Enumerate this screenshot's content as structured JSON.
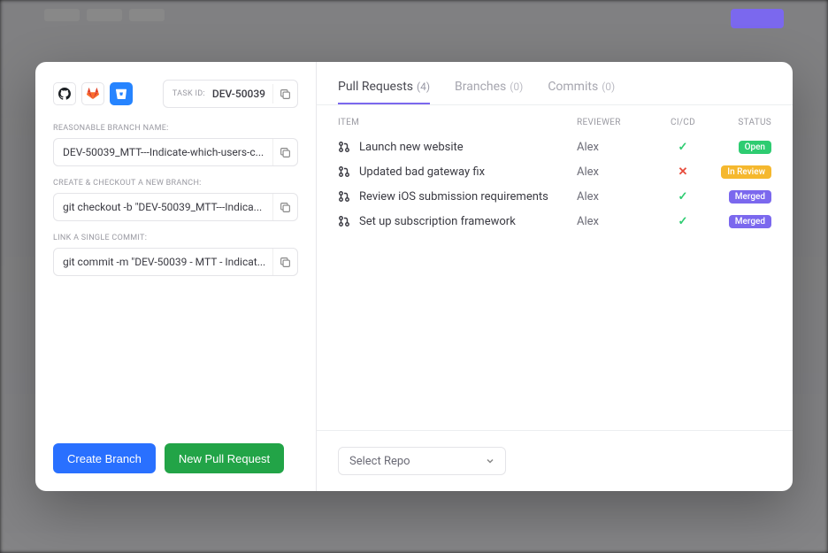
{
  "task": {
    "id_label": "TASK ID:",
    "id": "DEV-50039"
  },
  "fields": {
    "branch_name_label": "REASONABLE BRANCH NAME:",
    "branch_name": "DEV-50039_MTT---Indicate-which-users-c...",
    "checkout_label": "CREATE & CHECKOUT A NEW BRANCH:",
    "checkout": "git checkout -b \"DEV-50039_MTT---Indica...",
    "commit_label": "LINK A SINGLE COMMIT:",
    "commit": "git commit -m \"DEV-50039 - MTT - Indicat..."
  },
  "buttons": {
    "create_branch": "Create Branch",
    "new_pr": "New Pull Request"
  },
  "tabs": {
    "pr_label": "Pull Requests",
    "pr_count": "(4)",
    "branches_label": "Branches",
    "branches_count": "(0)",
    "commits_label": "Commits",
    "commits_count": "(0)"
  },
  "columns": {
    "item": "ITEM",
    "reviewer": "REVIEWER",
    "cicd": "CI/CD",
    "status": "STATUS"
  },
  "pull_requests": [
    {
      "title": "Launch new website",
      "reviewer": "Alex",
      "ci": "pass",
      "status": "Open"
    },
    {
      "title": "Updated bad gateway fix",
      "reviewer": "Alex",
      "ci": "fail",
      "status": "In Review"
    },
    {
      "title": "Review iOS submission requirements",
      "reviewer": "Alex",
      "ci": "pass",
      "status": "Merged"
    },
    {
      "title": "Set up subscription framework",
      "reviewer": "Alex",
      "ci": "pass",
      "status": "Merged"
    }
  ],
  "footer": {
    "select_repo": "Select Repo"
  },
  "status_labels": {
    "Open": "Open",
    "In Review": "In Review",
    "Merged": "Merged"
  }
}
